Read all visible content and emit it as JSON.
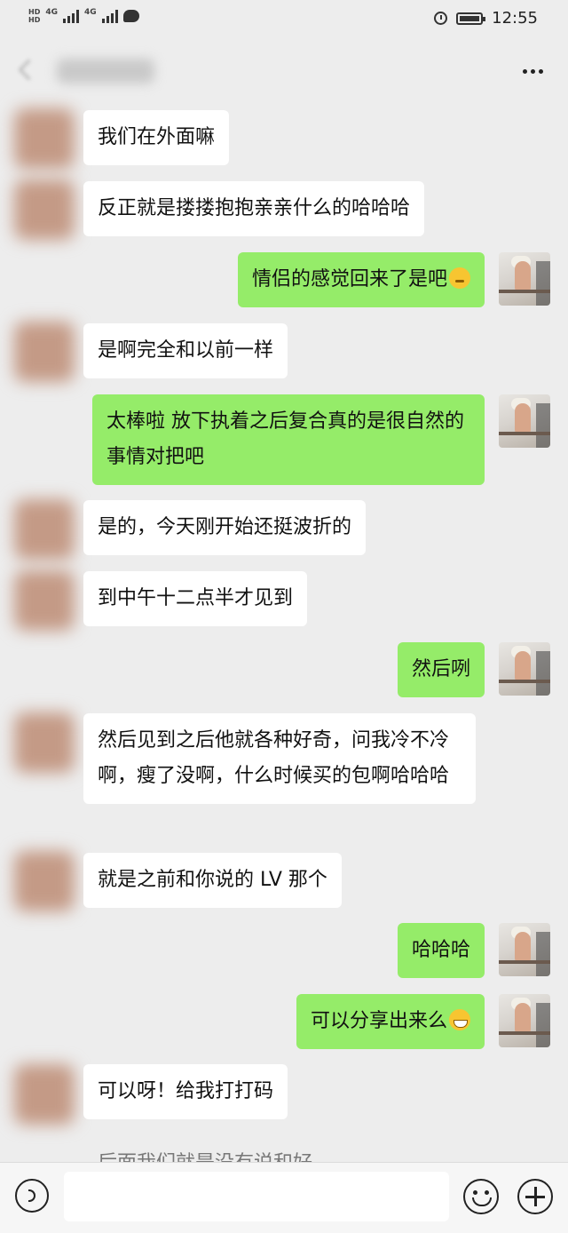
{
  "status_bar": {
    "sim1_hd": "HD",
    "sim2_hd": "HD",
    "network1": "4G",
    "network2": "4G",
    "time": "12:55"
  },
  "messages": [
    {
      "side": "left",
      "text": "我们在外面嘛"
    },
    {
      "side": "left",
      "text": "反正就是搂搂抱抱亲亲什么的哈哈哈"
    },
    {
      "side": "right",
      "text": "情侣的感觉回来了是吧",
      "emoji": "thinking-emoji"
    },
    {
      "side": "left",
      "text": "是啊完全和以前一样"
    },
    {
      "side": "right",
      "text": "太棒啦 放下执着之后复合真的是很自然的事情对把吧"
    },
    {
      "side": "left",
      "text": "是的，今天刚开始还挺波折的"
    },
    {
      "side": "left",
      "text": "到中午十二点半才见到"
    },
    {
      "side": "right",
      "text": "然后咧"
    },
    {
      "side": "left",
      "text": "然后见到之后他就各种好奇，问我冷不冷啊，瘦了没啊，什么时候买的包啊哈哈哈"
    },
    {
      "side": "left",
      "text": "就是之前和你说的 LV 那个"
    },
    {
      "side": "right",
      "text": "哈哈哈"
    },
    {
      "side": "right",
      "text": "可以分享出来么",
      "emoji": "grin-emoji"
    },
    {
      "side": "left",
      "text": "可以呀！给我打打码"
    },
    {
      "side": "left",
      "text": "后面我们就是没有说和好"
    }
  ],
  "colors": {
    "background": "#ededed",
    "incoming_bubble": "#ffffff",
    "outgoing_bubble": "#95ec69"
  }
}
